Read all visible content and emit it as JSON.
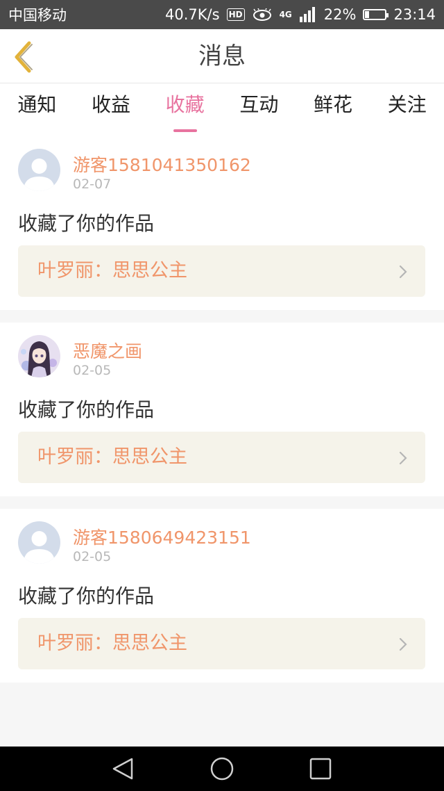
{
  "status_bar": {
    "carrier": "中国移动",
    "speed": "40.7K/s",
    "hd": "HD",
    "network": "4G",
    "battery": "22%",
    "battery_level": 0.22,
    "time": "23:14"
  },
  "header": {
    "title": "消息"
  },
  "tabs": [
    {
      "label": "通知"
    },
    {
      "label": "收益"
    },
    {
      "label": "收藏",
      "active": true
    },
    {
      "label": "互动"
    },
    {
      "label": "鲜花"
    },
    {
      "label": "关注"
    }
  ],
  "messages": [
    {
      "username": "游客1581041350162",
      "date": "02-07",
      "action": "收藏了你的作品",
      "work": "叶罗丽：思思公主",
      "avatar": "default-avatar"
    },
    {
      "username": "恶魔之画",
      "date": "02-05",
      "action": "收藏了你的作品",
      "work": "叶罗丽：思思公主",
      "avatar": "anime-girl-avatar"
    },
    {
      "username": "游客1580649423151",
      "date": "02-05",
      "action": "收藏了你的作品",
      "work": "叶罗丽：思思公主",
      "avatar": "default-avatar"
    }
  ],
  "colors": {
    "accent": "#e8739f",
    "link": "#f0956a",
    "back_arrow": "#e2b23a"
  }
}
